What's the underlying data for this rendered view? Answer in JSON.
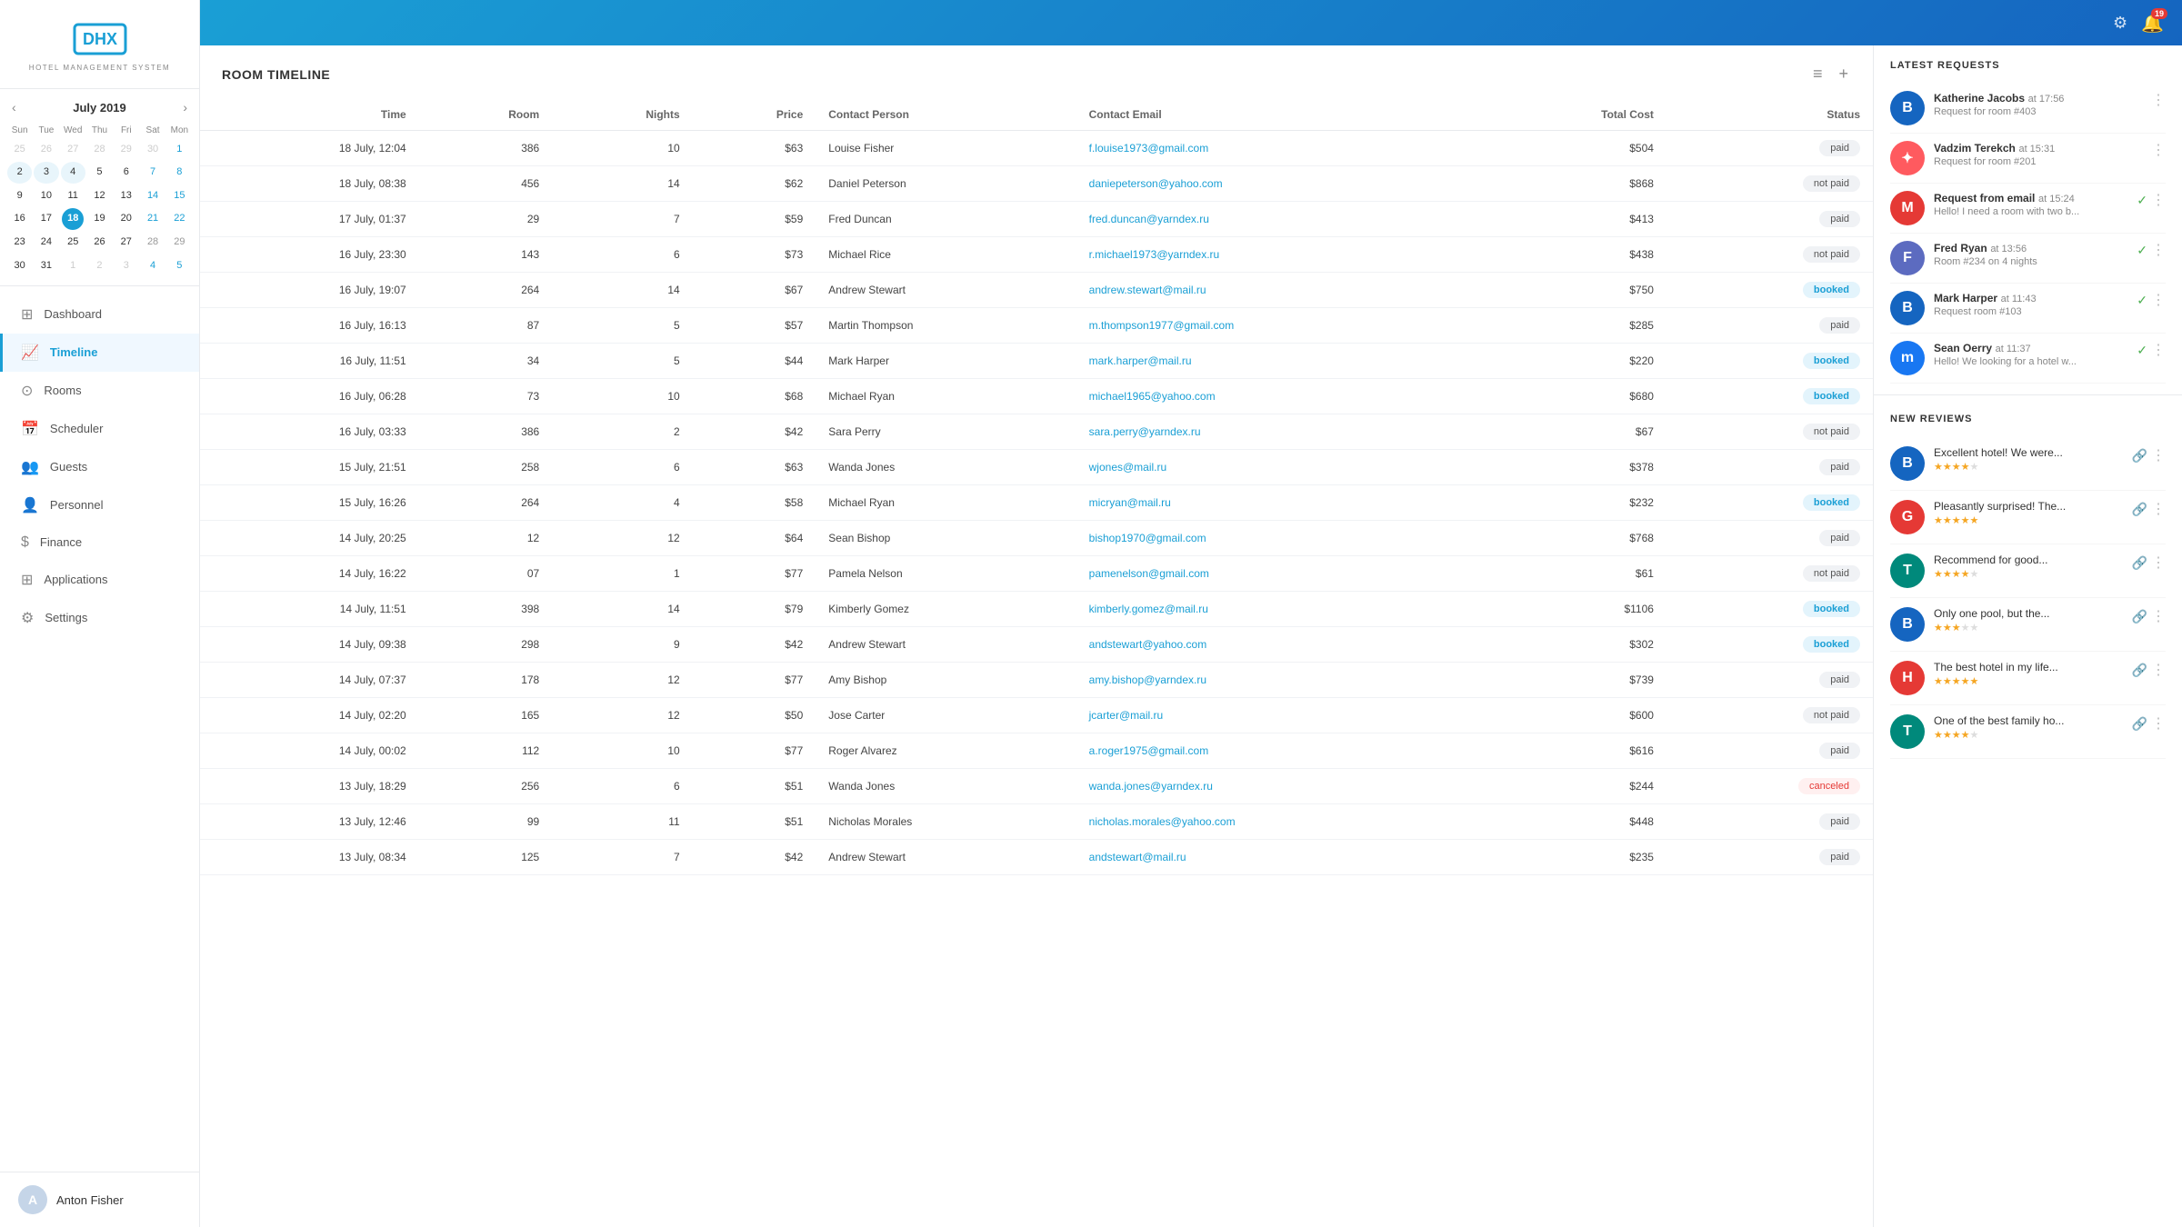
{
  "app": {
    "title": "DHX Hotel Management System",
    "logo_main": "DHX",
    "logo_sub": "HOTEL MANAGEMENT SYSTEM",
    "notif_count": "19"
  },
  "calendar": {
    "month": "July 2019",
    "day_labels": [
      "Sun",
      "Tue",
      "Wed",
      "Thu",
      "Fri",
      "Sat",
      "Mon"
    ],
    "weeks": [
      [
        "25",
        "26",
        "27",
        "28",
        "29",
        "30",
        "1"
      ],
      [
        "2",
        "3",
        "4",
        "5",
        "6",
        "7",
        "8"
      ],
      [
        "9",
        "10",
        "11",
        "12",
        "13",
        "14",
        "15"
      ],
      [
        "16",
        "17",
        "18",
        "19",
        "20",
        "21",
        "22"
      ],
      [
        "23",
        "24",
        "25",
        "26",
        "27",
        "28",
        "29"
      ],
      [
        "30",
        "31",
        "1",
        "2",
        "3",
        "4",
        "5"
      ]
    ],
    "today": "18",
    "other_start": [
      "25",
      "26",
      "27",
      "28",
      "29",
      "30"
    ],
    "other_end": [
      "1",
      "2",
      "3",
      "4",
      "5"
    ],
    "last_row_others": [
      "1",
      "2",
      "3",
      "4",
      "5"
    ]
  },
  "nav": {
    "items": [
      {
        "id": "dashboard",
        "label": "Dashboard",
        "icon": "⊞"
      },
      {
        "id": "timeline",
        "label": "Timeline",
        "icon": "📈",
        "active": true
      },
      {
        "id": "rooms",
        "label": "Rooms",
        "icon": "⊙"
      },
      {
        "id": "scheduler",
        "label": "Scheduler",
        "icon": "📅"
      },
      {
        "id": "guests",
        "label": "Guests",
        "icon": "👥"
      },
      {
        "id": "personnel",
        "label": "Personnel",
        "icon": "👤"
      },
      {
        "id": "finance",
        "label": "Finance",
        "icon": "$"
      },
      {
        "id": "applications",
        "label": "Applications",
        "icon": "⊞"
      },
      {
        "id": "settings",
        "label": "Settings",
        "icon": "⚙"
      }
    ]
  },
  "user": {
    "name": "Anton Fisher",
    "initials": "A"
  },
  "table": {
    "title": "ROOM TIMELINE",
    "columns": [
      "Time",
      "Room",
      "Nights",
      "Price",
      "Contact Person",
      "Contact Email",
      "Total Cost",
      "Status"
    ],
    "rows": [
      {
        "time": "18 July, 12:04",
        "room": "386",
        "nights": "10",
        "price": "$63",
        "person": "Louise Fisher",
        "email": "f.louise1973@gmail.com",
        "total": "$504",
        "status": "paid"
      },
      {
        "time": "18 July, 08:38",
        "room": "456",
        "nights": "14",
        "price": "$62",
        "person": "Daniel Peterson",
        "email": "daniepeterson@yahoo.com",
        "total": "$868",
        "status": "not paid"
      },
      {
        "time": "17 July, 01:37",
        "room": "29",
        "nights": "7",
        "price": "$59",
        "person": "Fred Duncan",
        "email": "fred.duncan@yarndex.ru",
        "total": "$413",
        "status": "paid"
      },
      {
        "time": "16 July, 23:30",
        "room": "143",
        "nights": "6",
        "price": "$73",
        "person": "Michael Rice",
        "email": "r.michael1973@yarndex.ru",
        "total": "$438",
        "status": "not paid"
      },
      {
        "time": "16 July, 19:07",
        "room": "264",
        "nights": "14",
        "price": "$67",
        "person": "Andrew Stewart",
        "email": "andrew.stewart@mail.ru",
        "total": "$750",
        "status": "booked"
      },
      {
        "time": "16 July, 16:13",
        "room": "87",
        "nights": "5",
        "price": "$57",
        "person": "Martin Thompson",
        "email": "m.thompson1977@gmail.com",
        "total": "$285",
        "status": "paid"
      },
      {
        "time": "16 July, 11:51",
        "room": "34",
        "nights": "5",
        "price": "$44",
        "person": "Mark Harper",
        "email": "mark.harper@mail.ru",
        "total": "$220",
        "status": "booked"
      },
      {
        "time": "16 July, 06:28",
        "room": "73",
        "nights": "10",
        "price": "$68",
        "person": "Michael Ryan",
        "email": "michael1965@yahoo.com",
        "total": "$680",
        "status": "booked"
      },
      {
        "time": "16 July, 03:33",
        "room": "386",
        "nights": "2",
        "price": "$42",
        "person": "Sara Perry",
        "email": "sara.perry@yarndex.ru",
        "total": "$67",
        "status": "not paid"
      },
      {
        "time": "15 July, 21:51",
        "room": "258",
        "nights": "6",
        "price": "$63",
        "person": "Wanda Jones",
        "email": "wjones@mail.ru",
        "total": "$378",
        "status": "paid"
      },
      {
        "time": "15 July, 16:26",
        "room": "264",
        "nights": "4",
        "price": "$58",
        "person": "Michael Ryan",
        "email": "micryan@mail.ru",
        "total": "$232",
        "status": "booked"
      },
      {
        "time": "14 July, 20:25",
        "room": "12",
        "nights": "12",
        "price": "$64",
        "person": "Sean Bishop",
        "email": "bishop1970@gmail.com",
        "total": "$768",
        "status": "paid"
      },
      {
        "time": "14 July, 16:22",
        "room": "07",
        "nights": "1",
        "price": "$77",
        "person": "Pamela Nelson",
        "email": "pamenelson@gmail.com",
        "total": "$61",
        "status": "not paid"
      },
      {
        "time": "14 July, 11:51",
        "room": "398",
        "nights": "14",
        "price": "$79",
        "person": "Kimberly Gomez",
        "email": "kimberly.gomez@mail.ru",
        "total": "$1106",
        "status": "booked"
      },
      {
        "time": "14 July, 09:38",
        "room": "298",
        "nights": "9",
        "price": "$42",
        "person": "Andrew Stewart",
        "email": "andstewart@yahoo.com",
        "total": "$302",
        "status": "booked"
      },
      {
        "time": "14 July, 07:37",
        "room": "178",
        "nights": "12",
        "price": "$77",
        "person": "Amy Bishop",
        "email": "amy.bishop@yarndex.ru",
        "total": "$739",
        "status": "paid"
      },
      {
        "time": "14 July, 02:20",
        "room": "165",
        "nights": "12",
        "price": "$50",
        "person": "Jose Carter",
        "email": "jcarter@mail.ru",
        "total": "$600",
        "status": "not paid"
      },
      {
        "time": "14 July, 00:02",
        "room": "112",
        "nights": "10",
        "price": "$77",
        "person": "Roger Alvarez",
        "email": "a.roger1975@gmail.com",
        "total": "$616",
        "status": "paid"
      },
      {
        "time": "13 July, 18:29",
        "room": "256",
        "nights": "6",
        "price": "$51",
        "person": "Wanda Jones",
        "email": "wanda.jones@yarndex.ru",
        "total": "$244",
        "status": "canceled"
      },
      {
        "time": "13 July, 12:46",
        "room": "99",
        "nights": "11",
        "price": "$51",
        "person": "Nicholas Morales",
        "email": "nicholas.morales@yahoo.com",
        "total": "$448",
        "status": "paid"
      },
      {
        "time": "13 July, 08:34",
        "room": "125",
        "nights": "7",
        "price": "$42",
        "person": "Andrew Stewart",
        "email": "andstewart@mail.ru",
        "total": "$235",
        "status": "paid"
      }
    ]
  },
  "latest_requests": {
    "title": "LATEST REQUESTS",
    "items": [
      {
        "name": "Katherine Jacobs",
        "time": "at 17:56",
        "desc": "Request for room #403",
        "avatar_color": "#1565c0",
        "avatar_letter": "B",
        "source": "B",
        "check": false
      },
      {
        "name": "Vadzim Terekch",
        "time": "at 15:31",
        "desc": "Request for room #201",
        "avatar_color": "#ff5722",
        "avatar_letter": "A",
        "source": "airbnb",
        "check": false
      },
      {
        "name": "Request from email",
        "time": "at 15:24",
        "desc": "Hello! I need a room with two b...",
        "avatar_color": "#e53935",
        "avatar_letter": "M",
        "source": "gmail",
        "check": true
      },
      {
        "name": "Fred Ryan",
        "time": "at 13:56",
        "desc": "Room #234 on 4 nights",
        "avatar_color": "#5c6bc0",
        "avatar_letter": "F",
        "source": "photo",
        "check": true
      },
      {
        "name": "Mark Harper",
        "time": "at 11:43",
        "desc": "Request room #103",
        "avatar_color": "#1565c0",
        "avatar_letter": "B",
        "source": "B",
        "check": true
      },
      {
        "name": "Sean Oerry",
        "time": "at 11:37",
        "desc": "Hello! We looking for a hotel w...",
        "avatar_color": "#1877f2",
        "avatar_letter": "M",
        "source": "messenger",
        "check": true
      }
    ]
  },
  "new_reviews": {
    "title": "NEW REVIEWS",
    "items": [
      {
        "text": "Excellent hotel! We were...",
        "stars": 4,
        "avatar_color": "#1565c0",
        "avatar_letter": "B",
        "avatar_text": "B"
      },
      {
        "text": "Pleasantly surprised! The...",
        "stars": 5,
        "avatar_color": "#e53935",
        "avatar_letter": "G",
        "avatar_text": "G"
      },
      {
        "text": "Recommend for good...",
        "stars": 4,
        "avatar_color": "#00897b",
        "avatar_letter": "T",
        "avatar_text": "T"
      },
      {
        "text": "Only one pool, but the...",
        "stars": 3,
        "avatar_color": "#1565c0",
        "avatar_letter": "B",
        "avatar_text": "B"
      },
      {
        "text": "The best hotel in my life...",
        "stars": 5,
        "avatar_color": "#e53935",
        "avatar_letter": "H",
        "avatar_text": "H"
      },
      {
        "text": "One of the best family ho...",
        "stars": 4,
        "avatar_color": "#00897b",
        "avatar_letter": "T",
        "avatar_text": "T"
      }
    ]
  }
}
